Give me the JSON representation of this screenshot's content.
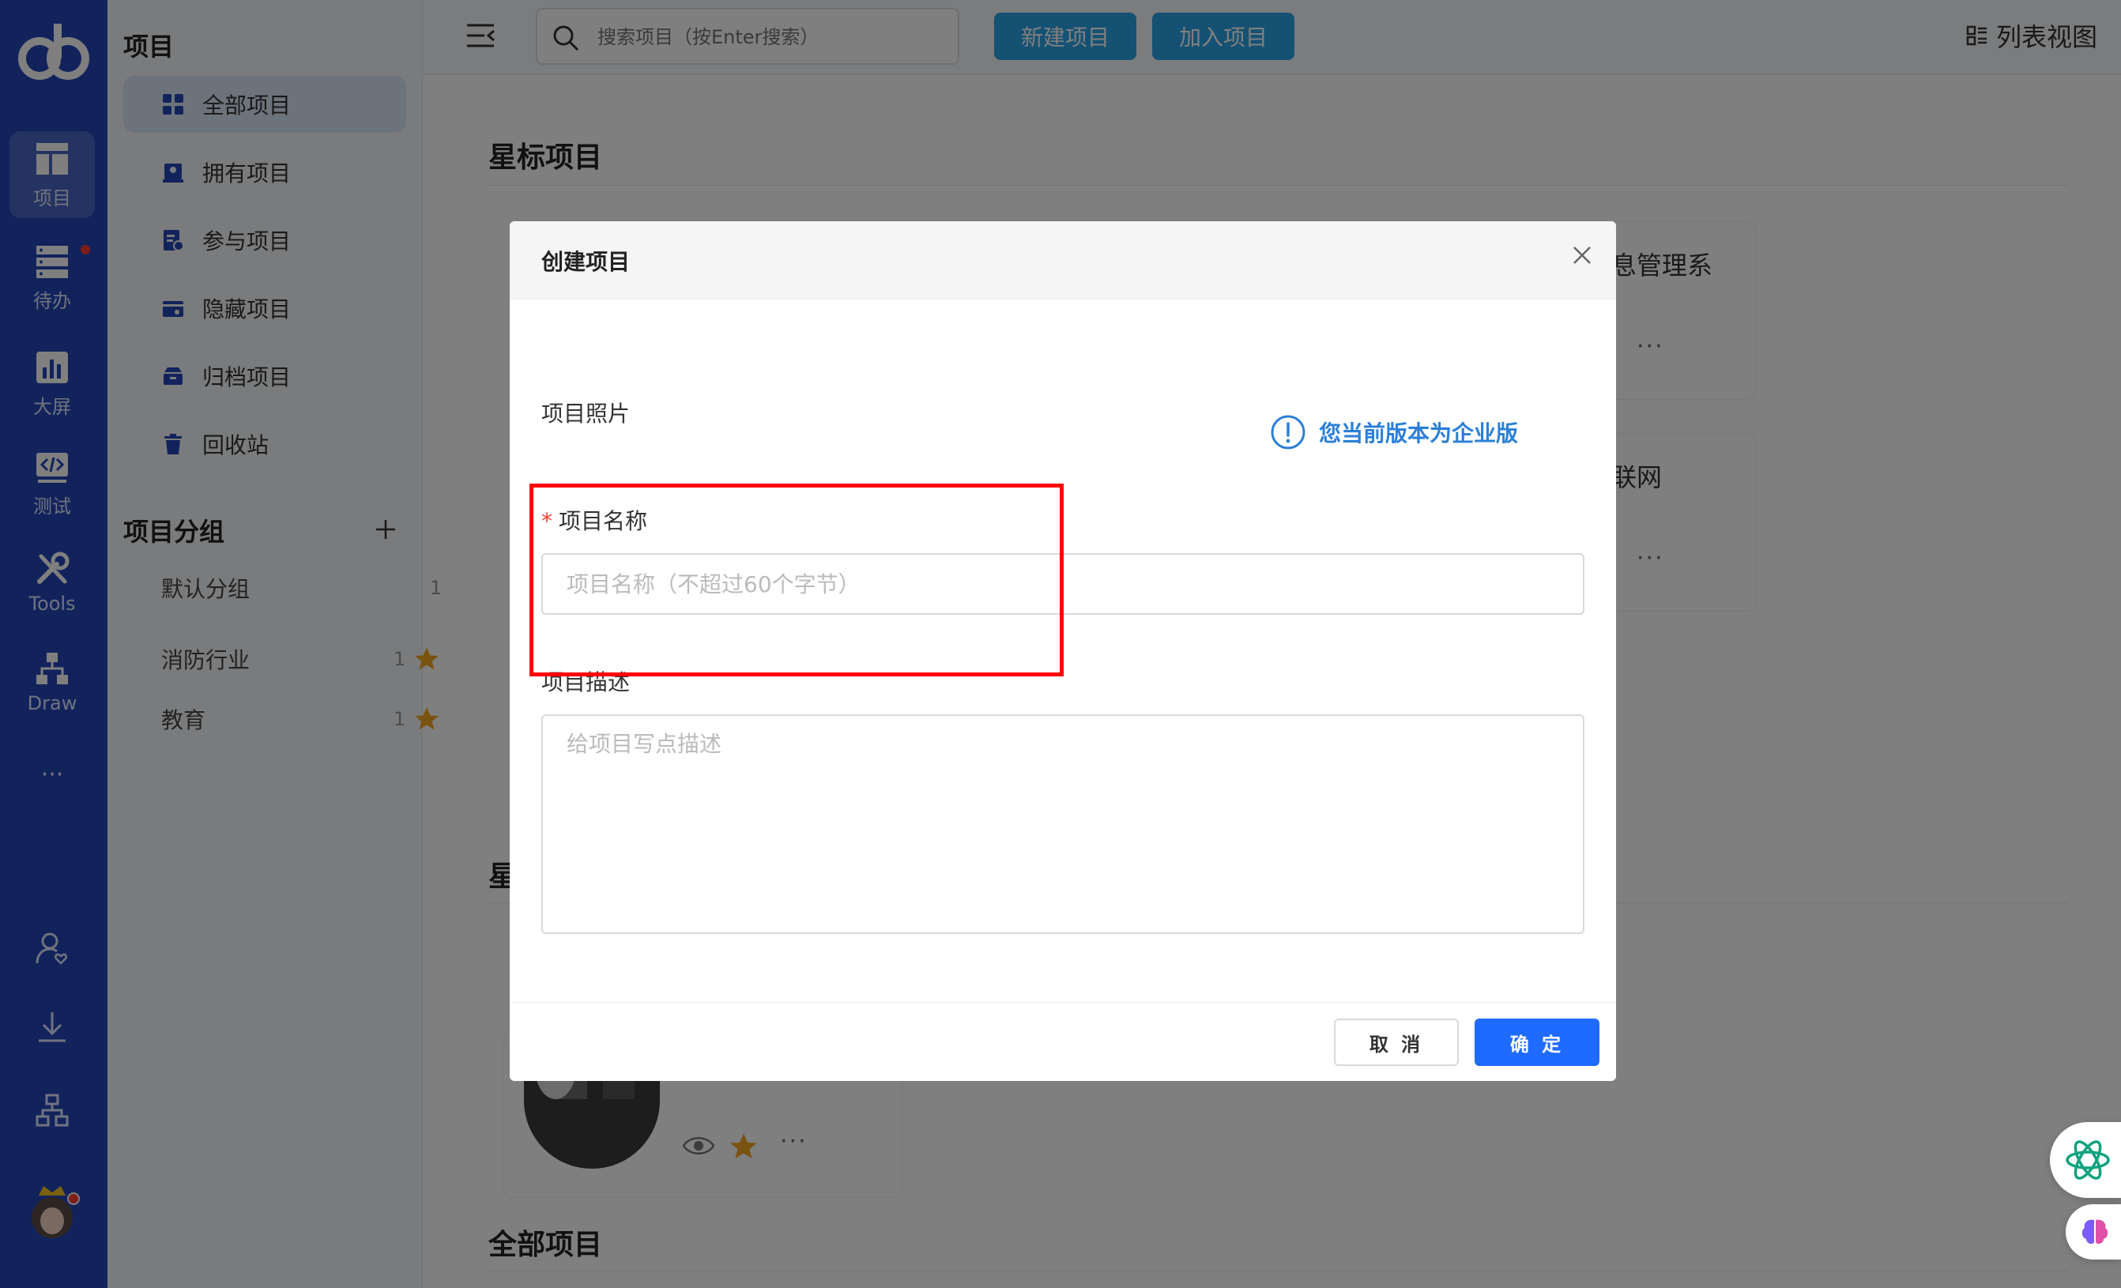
{
  "rail": {
    "items": [
      {
        "label": "项目"
      },
      {
        "label": "待办"
      },
      {
        "label": "大屏"
      },
      {
        "label": "测试"
      },
      {
        "label": "Tools"
      },
      {
        "label": "Draw"
      }
    ],
    "more": "···"
  },
  "subnav": {
    "title": "项目",
    "items": [
      {
        "label": "全部项目"
      },
      {
        "label": "拥有项目"
      },
      {
        "label": "参与项目"
      },
      {
        "label": "隐藏项目"
      },
      {
        "label": "归档项目"
      },
      {
        "label": "回收站"
      }
    ],
    "groups_title": "项目分组",
    "groups": [
      {
        "label": "默认分组",
        "count": "1"
      },
      {
        "label": "消防行业",
        "count": "1"
      },
      {
        "label": "教育",
        "count": "1"
      }
    ]
  },
  "topbar": {
    "search_placeholder": "搜索项目（按Enter搜索）",
    "new_project": "新建项目",
    "join_project": "加入项目",
    "view_toggle": "列表视图"
  },
  "content": {
    "starred_title": "星标项目",
    "second_title_partial": "星",
    "all_title": "全部项目",
    "card1_text": "息管理系",
    "card2_text": "联网",
    "ellipsis": "···"
  },
  "modal": {
    "title": "创建项目",
    "photo_label": "项目照片",
    "notice": "您当前版本为企业版",
    "name_required": "*",
    "name_label": "项目名称",
    "name_placeholder": "项目名称（不超过60个字节）",
    "desc_label": "项目描述",
    "desc_placeholder": "给项目写点描述",
    "cancel": "取 消",
    "ok": "确 定"
  },
  "colors": {
    "rail": "#2446b8",
    "primary_button": "#1f6bff",
    "topbar_button": "#2aa3e6",
    "notice": "#2b7fd8",
    "star": "#f5a623",
    "highlight": "#ff0000"
  }
}
